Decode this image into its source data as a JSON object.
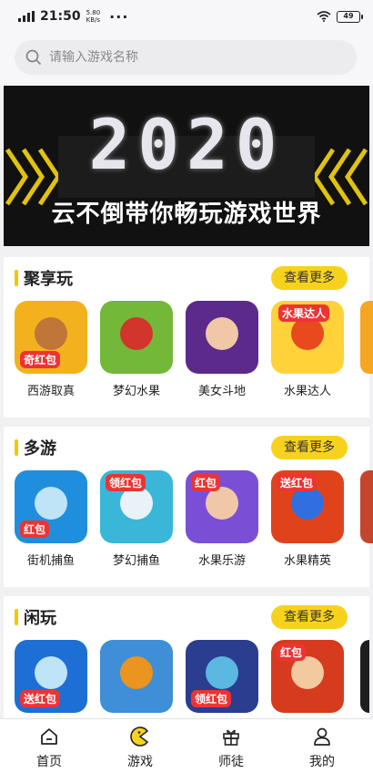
{
  "status": {
    "time": "21:50",
    "speed_value": "5.80",
    "speed_unit": "KB/s",
    "more": "···",
    "battery": "49"
  },
  "search": {
    "placeholder": "请输入游戏名称"
  },
  "banner": {
    "year": "2020",
    "slogan": "云不倒带你畅玩游戏世界"
  },
  "sections": [
    {
      "title": "聚享玩",
      "more": "查看更多",
      "games": [
        {
          "name": "西游取真",
          "badge": "奇红包",
          "color": "#f3b21d"
        },
        {
          "name": "梦幻水果",
          "badge": "",
          "color": "#74b83a"
        },
        {
          "name": "美女斗地",
          "badge": "",
          "color": "#5b2a8a"
        },
        {
          "name": "水果达人",
          "badge": "水果达人",
          "color": "#ffd23a"
        }
      ]
    },
    {
      "title": "多游",
      "more": "查看更多",
      "games": [
        {
          "name": "街机捕鱼",
          "badge": "红包",
          "color": "#1f8fdd"
        },
        {
          "name": "梦幻捕鱼",
          "badge": "领红包",
          "color": "#39b6d8"
        },
        {
          "name": "水果乐游",
          "badge": "红包",
          "color": "#7a4fd6"
        },
        {
          "name": "水果精英",
          "badge": "送红包",
          "color": "#e0431c"
        }
      ]
    },
    {
      "title": "闲玩",
      "more": "查看更多",
      "games": [
        {
          "badge": "送红包",
          "color": "#1d6fd6"
        },
        {
          "badge": "",
          "color": "#3e8ed8"
        },
        {
          "badge": "领红包",
          "color": "#2b3d8f"
        },
        {
          "badge": "红包",
          "color": "#d63b1d"
        }
      ]
    }
  ],
  "tabs": [
    {
      "label": "首页",
      "icon": "home-icon"
    },
    {
      "label": "游戏",
      "icon": "game-icon"
    },
    {
      "label": "师徒",
      "icon": "gift-icon"
    },
    {
      "label": "我的",
      "icon": "user-icon"
    }
  ]
}
